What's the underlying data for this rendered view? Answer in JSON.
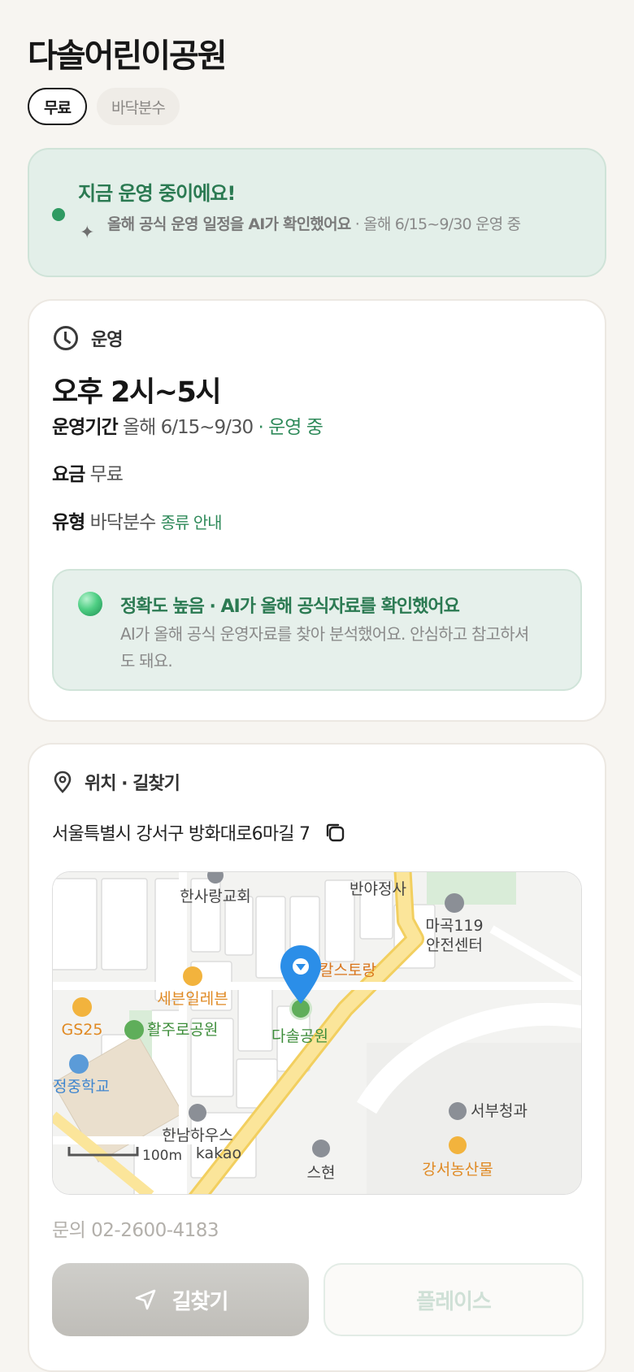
{
  "page": {
    "title": "다솔어린이공원"
  },
  "chips": [
    {
      "label": "무료",
      "active": true
    },
    {
      "label": "바닥분수",
      "active": false
    }
  ],
  "status": {
    "title": "지금 운영 중이에요!",
    "sub_strong": "올해 공식 운영 일정을 AI가 확인했어요",
    "sub_rest": " · 올해 6/15~9/30 운영 중",
    "icon": "sparkle-icon",
    "color": "#2b7a52"
  },
  "operation": {
    "header": "운영",
    "hours": "오후 2시~5시",
    "period_label": "운영기간",
    "period_value": "올해 6/15~9/30",
    "period_status": " · 운영 중",
    "fee_label": "요금",
    "fee_value": "무료",
    "type_label": "유형",
    "type_value": "바닥분수",
    "type_link": "종류 안내",
    "accuracy_title": "정확도 높음 · AI가 올해 공식자료를 확인했어요",
    "accuracy_body": "AI가 올해 공식 운영자료를 찾아 분석했어요. 안심하고 참고하셔도 돼요."
  },
  "location": {
    "header": "위치 · 길찾기",
    "address": "서울특별시 강서구 방화대로6마길 7",
    "map_labels": {
      "church": "한사랑교회",
      "temple": "반야정사",
      "fire": "마곡119",
      "fire2": "안전센터",
      "restaurant": "칼스토랑",
      "seven": "세븐일레븐",
      "gs25": "GS25",
      "park": "활주로공원",
      "dasol": "다솔공원",
      "school": "정중학교",
      "hannam": "한남하우스",
      "fruit": "서부청과",
      "market": "강서농산물",
      "scale": "100m",
      "brand": "kakao",
      "bottom": "스현"
    },
    "contact": "문의 02-2600-4183"
  },
  "actions": {
    "directions": "길찾기",
    "place": "플레이스"
  },
  "colors": {
    "accent": "#2b7a52",
    "status_bg": "#e3efe9",
    "marker": "#2b8ee8"
  }
}
